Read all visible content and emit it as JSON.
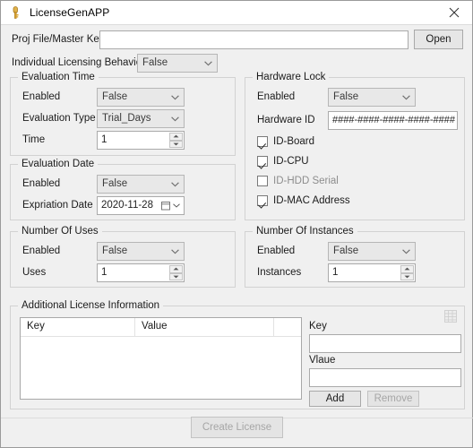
{
  "window": {
    "title": "LicenseGenAPP",
    "icon": "key-icon",
    "close_label": "Close"
  },
  "top": {
    "proj_label": "Proj File/Master Key",
    "proj_value": "",
    "proj_placeholder": "",
    "open_label": "Open",
    "individual_label": "Individual Licensing Behaviour",
    "individual_value": "False"
  },
  "evaluation_time": {
    "title": "Evaluation Time",
    "enabled_label": "Enabled",
    "enabled_value": "False",
    "type_label": "Evaluation Type",
    "type_value": "Trial_Days",
    "time_label": "Time",
    "time_value": "1"
  },
  "evaluation_date": {
    "title": "Evaluation Date",
    "enabled_label": "Enabled",
    "enabled_value": "False",
    "expiration_label": "Expriation Date",
    "expiration_value": "2020-11-28"
  },
  "number_of_uses": {
    "title": "Number Of Uses",
    "enabled_label": "Enabled",
    "enabled_value": "False",
    "uses_label": "Uses",
    "uses_value": "1"
  },
  "hardware_lock": {
    "title": "Hardware Lock",
    "enabled_label": "Enabled",
    "enabled_value": "False",
    "hwid_label": "Hardware ID",
    "hwid_value": "####-####-####-####-####",
    "checkboxes": [
      {
        "label": "ID-Board",
        "checked": true
      },
      {
        "label": "ID-CPU",
        "checked": true
      },
      {
        "label": "ID-HDD Serial",
        "checked": false
      },
      {
        "label": "ID-MAC Address",
        "checked": true
      }
    ]
  },
  "number_of_instances": {
    "title": "Number Of Instances",
    "enabled_label": "Enabled",
    "enabled_value": "False",
    "instances_label": "Instances",
    "instances_value": "1"
  },
  "additional": {
    "title": "Additional License Information",
    "columns": [
      "Key",
      "Value",
      ""
    ],
    "rows": [],
    "key_label": "Key",
    "key_value": "",
    "value_label": "Vlaue",
    "value_value": "",
    "add_label": "Add",
    "remove_label": "Remove",
    "remove_disabled": true,
    "grid_icon": "table-grid-icon"
  },
  "footer": {
    "create_label": "Create License",
    "create_disabled": true
  },
  "colors": {
    "window_bg": "#f0f0f0",
    "titlebar_bg": "#ffffff",
    "border": "#d2d2d2",
    "field_border": "#aaaaaa",
    "combo_bg": "#e8e8e8",
    "button_bg": "#e6e6e6",
    "disabled_text": "#a6a6a6",
    "icon_gold": "#d9a12b"
  }
}
